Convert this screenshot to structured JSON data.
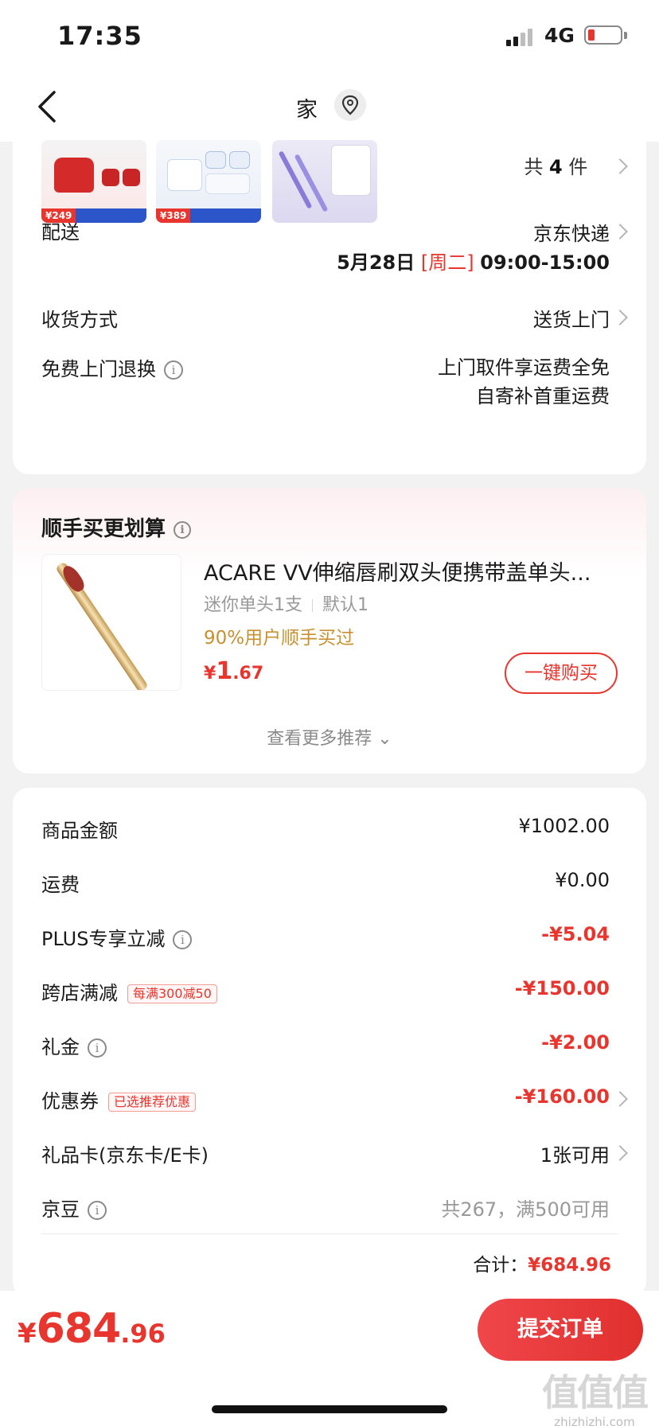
{
  "status_bar": {
    "time": "17:35",
    "network": "4G",
    "battery_color": "#e8352e"
  },
  "nav": {
    "title": "家"
  },
  "products": {
    "thumbnails": [
      {
        "price_tag": "¥249",
        "icon": "olay-red-cream-image"
      },
      {
        "price_tag": "¥389",
        "icon": "olay-blue-cream-image"
      },
      {
        "price_tag": "",
        "icon": "purple-eyeliner-image"
      }
    ],
    "count_prefix": "共",
    "count": "4",
    "count_suffix": "件"
  },
  "delivery": {
    "label": "配送",
    "carrier": "京东快递",
    "date": "5月28日",
    "weekday": "[周二]",
    "time_window": "09:00-15:00"
  },
  "receipt_method": {
    "label": "收货方式",
    "value": "送货上门"
  },
  "free_return": {
    "label": "免费上门退换",
    "line1": "上门取件享运费全免",
    "line2": "自寄补首重运费"
  },
  "recommend": {
    "title": "顺手买更划算",
    "product_name": "ACARE VV伸缩唇刷双头便携带盖单头...",
    "spec": "迷你单头1支",
    "variant": "默认1",
    "buyers": "90%用户顺手买过",
    "price_currency": "¥",
    "price_int": "1",
    "price_dec": ".67",
    "buy_button": "一键购买",
    "more": "查看更多推荐 ⌄"
  },
  "price_rows": [
    {
      "label": "商品金额",
      "value": "¥1002.00",
      "red": false,
      "info": false,
      "tag": "",
      "chevron": false
    },
    {
      "label": "运费",
      "value": "¥0.00",
      "red": false,
      "info": false,
      "tag": "",
      "chevron": false
    },
    {
      "label": "PLUS专享立减",
      "value": "-¥5.04",
      "red": true,
      "info": true,
      "tag": "",
      "chevron": false
    },
    {
      "label": "跨店满减",
      "value": "-¥150.00",
      "red": true,
      "info": false,
      "tag": "每满300减50",
      "chevron": false
    },
    {
      "label": "礼金",
      "value": "-¥2.00",
      "red": true,
      "info": true,
      "tag": "",
      "chevron": false
    },
    {
      "label": "优惠券",
      "value": "-¥160.00",
      "red": true,
      "info": false,
      "tag": "已选推荐优惠",
      "chevron": true
    },
    {
      "label": "礼品卡(京东卡/E卡)",
      "value": "1张可用",
      "red": false,
      "info": false,
      "tag": "",
      "chevron": true
    },
    {
      "label": "京豆",
      "value": "共267，满500可用",
      "red": false,
      "info": true,
      "tag": "",
      "chevron": false,
      "muted": true
    }
  ],
  "total": {
    "label": "合计：",
    "value": "¥684.96"
  },
  "bottom": {
    "price_currency": "¥",
    "price_int": "684",
    "price_dec": ".96",
    "submit": "提交订单"
  },
  "watermark": {
    "logo": "值值值",
    "site": "zhizhizhi.com"
  },
  "colors": {
    "accent": "#e8352e",
    "gold": "#c8902f",
    "muted": "#999999"
  }
}
